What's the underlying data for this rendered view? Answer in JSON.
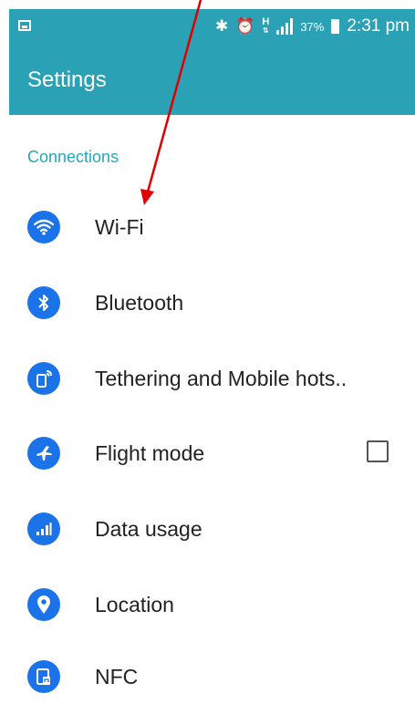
{
  "status_bar": {
    "bluetooth_icon": "bluetooth-icon",
    "alarm_icon": "alarm-icon",
    "network_type": "H",
    "battery_percent": "37%",
    "time": "2:31 pm"
  },
  "app_bar": {
    "title": "Settings"
  },
  "section": {
    "title": "Connections"
  },
  "settings_items": [
    {
      "label": "Wi-Fi",
      "icon": "wifi-icon"
    },
    {
      "label": "Bluetooth",
      "icon": "bluetooth-icon"
    },
    {
      "label": "Tethering and Mobile hots..",
      "icon": "tethering-icon"
    },
    {
      "label": "Flight mode",
      "icon": "airplane-icon",
      "checked": false
    },
    {
      "label": "Data usage",
      "icon": "data-usage-icon"
    },
    {
      "label": "Location",
      "icon": "location-pin-icon"
    },
    {
      "label": "NFC",
      "icon": "nfc-icon"
    }
  ],
  "colors": {
    "header_teal": "#2aa1b4",
    "section_teal": "#25a6b8",
    "icon_blue": "#1a73e8",
    "arrow_red": "#e00000"
  }
}
